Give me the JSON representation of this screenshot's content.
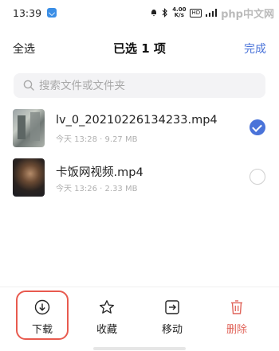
{
  "status_bar": {
    "time": "13:39",
    "net_speed": "4.00",
    "net_unit": "K/s",
    "hd_badge": "HD",
    "watermark": "php中文网"
  },
  "header": {
    "select_all": "全选",
    "title": "已选 1 项",
    "done": "完成"
  },
  "search": {
    "placeholder": "搜索文件或文件夹"
  },
  "files": [
    {
      "name": "lv_0_20210226134233.mp4",
      "meta": "今天 13:28 · 9.27 MB",
      "selected": true
    },
    {
      "name": "卡饭网视频.mp4",
      "meta": "今天 13:26 · 2.33 MB",
      "selected": false
    }
  ],
  "actions": [
    {
      "label": "下载",
      "icon": "download-icon"
    },
    {
      "label": "收藏",
      "icon": "star-icon"
    },
    {
      "label": "移动",
      "icon": "move-icon"
    },
    {
      "label": "删除",
      "icon": "trash-icon"
    }
  ],
  "colors": {
    "accent": "#4a73d9",
    "delete": "#e0645a",
    "highlight": "#e85a4f"
  }
}
